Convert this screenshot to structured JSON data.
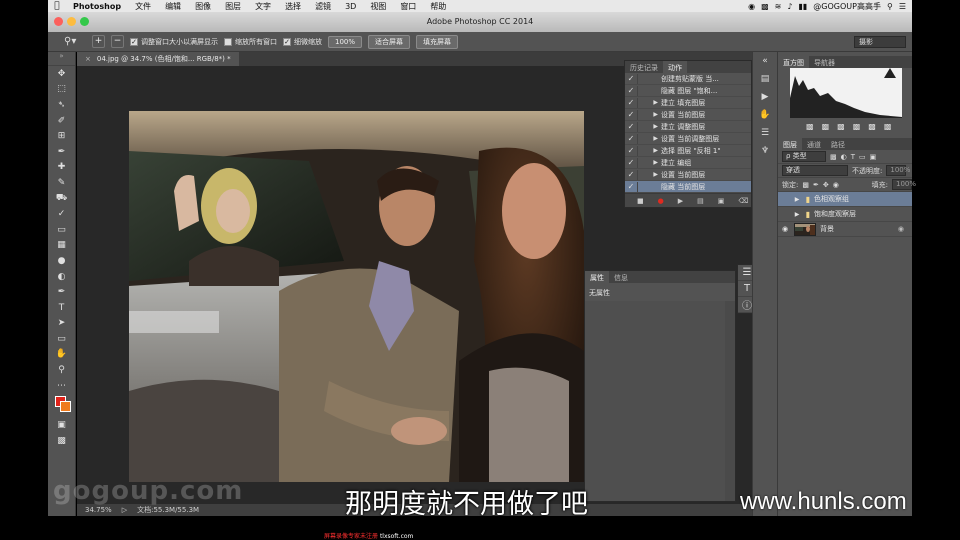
{
  "menubar": {
    "app": "Photoshop",
    "items": [
      "文件",
      "编辑",
      "图像",
      "图层",
      "文字",
      "选择",
      "滤镜",
      "3D",
      "视图",
      "窗口",
      "帮助"
    ],
    "user": "@GOGOUP高高手"
  },
  "window": {
    "title": "Adobe Photoshop CC 2014"
  },
  "options": {
    "check1": "调整窗口大小以满屏显示",
    "check2": "缩放所有窗口",
    "check3": "细微缩放",
    "zoom_button": "100%",
    "fit_button": "适合屏幕",
    "fill_button": "填充屏幕",
    "workspace": "摄影"
  },
  "document": {
    "tab_label": "04.jpg @ 34.7% (色相/饱和... RGB/8*) *",
    "zoom": "34.75%",
    "doc_size": "文档:55.3M/55.3M"
  },
  "actions_panel": {
    "tabs": [
      "历史记录",
      "动作"
    ],
    "rows": [
      {
        "label": "创建剪贴蒙版 当..."
      },
      {
        "label": "隐藏 图层 \"饱和..."
      },
      {
        "label": "建立 填充图层"
      },
      {
        "label": "设置 当前图层"
      },
      {
        "label": "建立 调整图层"
      },
      {
        "label": "设置 当前调整图层"
      },
      {
        "label": "选择 图层 \"反相 1\""
      },
      {
        "label": "建立 编组"
      },
      {
        "label": "设置 当前图层"
      },
      {
        "label": "隐藏 当前图层"
      }
    ]
  },
  "properties_panel": {
    "tabs": [
      "属性",
      "信息"
    ],
    "empty_label": "无属性"
  },
  "histogram": {
    "tabs": [
      "直方图",
      "导航器"
    ]
  },
  "layers_panel": {
    "tabs": [
      "图层",
      "通道",
      "路径"
    ],
    "filter_label": "ρ 类型",
    "blend_mode": "穿透",
    "opacity_label": "不透明度:",
    "opacity_value": "100%",
    "lock_label": "锁定:",
    "fill_label": "填充:",
    "fill_value": "100%",
    "layers": [
      {
        "name": "色相观察组"
      },
      {
        "name": "饱和度观察层"
      },
      {
        "name": "背景"
      }
    ]
  },
  "overlay": {
    "subtitle": "那明度就不用做了吧",
    "watermark_left": "gogoup.com",
    "watermark_right": "www.hunls.com",
    "software_note_1": "屏幕录像专家未注册",
    "software_note_2": "tlxsoft.com"
  },
  "colors": {
    "foreground": "#e0231b",
    "background": "#ef7b1e",
    "selection": "#6b7d97"
  }
}
